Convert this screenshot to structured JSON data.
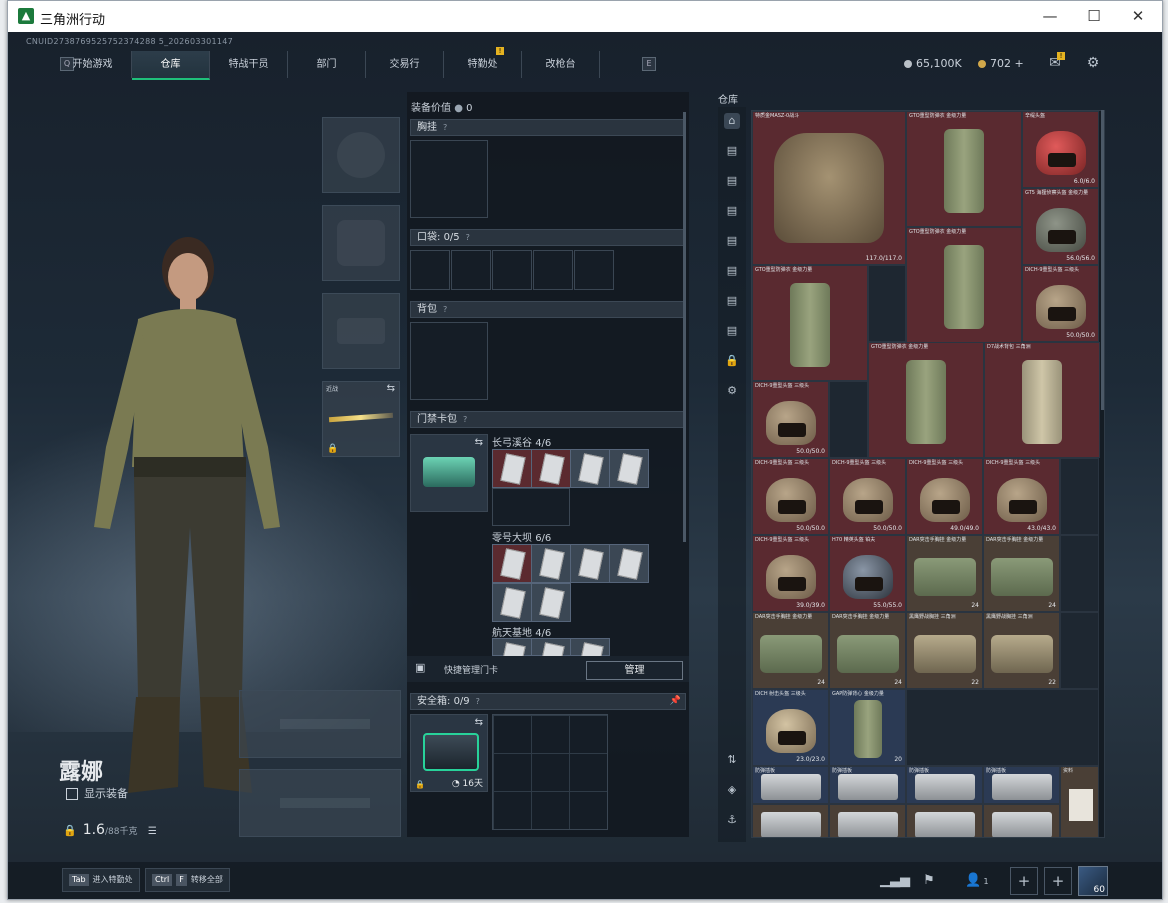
{
  "window": {
    "title": "三角洲行动",
    "minimize": "—",
    "maximize": "☐",
    "close": "✕"
  },
  "header": {
    "uid": "CNUID2738769525752374288 5_202603301147",
    "nav_left_key": "Q",
    "nav_right_key": "E",
    "tabs": [
      {
        "label": "开始游戏",
        "active": false
      },
      {
        "label": "仓库",
        "active": true
      },
      {
        "label": "特战干员",
        "active": false
      },
      {
        "label": "部门",
        "active": false
      },
      {
        "label": "交易行",
        "active": false
      },
      {
        "label": "特勤处",
        "active": false,
        "badge": "!"
      },
      {
        "label": "改枪台",
        "active": false
      }
    ],
    "currency_coins": "65,100K",
    "currency_tokens": "702",
    "plus": "+",
    "mail_badge": "!"
  },
  "character": {
    "name": "露娜",
    "show_equipment": "显示装备",
    "weight": "1.6",
    "weight_max": "/88千克",
    "melee_label": "近战"
  },
  "loadout": {
    "equip_value_label": "装备价值",
    "equip_value": "0",
    "chest_rig": "胸挂",
    "pocket": "口袋:",
    "pocket_count": "0/5",
    "backpack": "背包",
    "keycard_case": "门禁卡包",
    "groups": [
      {
        "name": "长弓溪谷",
        "count": "4/6"
      },
      {
        "name": "零号大坝",
        "count": "6/6"
      },
      {
        "name": "航天基地",
        "count": "4/6"
      }
    ],
    "quick_manage": "快捷管理门卡",
    "manage": "管理",
    "safe_box": "安全箱:",
    "safe_count": "0/9",
    "safe_timer": "16天"
  },
  "storage": {
    "label": "仓库",
    "items": [
      {
        "name": "特质金MASZ-0战斗",
        "dur": "117.0/117.0"
      },
      {
        "name": "GTO重型防弹衣 金级力量",
        "dur": ""
      },
      {
        "name": "辛缇头盔",
        "dur": "6.0/6.0"
      },
      {
        "name": "GT5 海狸侦察头盔 金级力量",
        "dur": "56.0/56.0"
      },
      {
        "name": "GTO重型防弹衣 金级力量",
        "dur": ""
      },
      {
        "name": "GTO重型防弹衣 金级力量",
        "dur": ""
      },
      {
        "name": "DICH-9重型头盔 三级头",
        "dur": "50.0/50.0"
      },
      {
        "name": "GTO重型防弹衣 金级力量",
        "dur": ""
      },
      {
        "name": "D7战术背包 三角洲",
        "dur": ""
      },
      {
        "name": "DICH-9重型头盔 三级头",
        "dur": "50.0/50.0"
      },
      {
        "name": "DICH-9重型头盔 三级头",
        "dur": "50.0/50.0"
      },
      {
        "name": "DICH-9重型头盔 三级头",
        "dur": "50.0/50.0"
      },
      {
        "name": "DICH-9重型头盔 三级头",
        "dur": "49.0/49.0"
      },
      {
        "name": "DICH-9重型头盔 三级头",
        "dur": "43.0/43.0"
      },
      {
        "name": "DICH-9重型头盔 三级头",
        "dur": "39.0/39.0"
      },
      {
        "name": "H70 精英头盔 铂夫",
        "dur": "55.0/55.0"
      },
      {
        "name": "DAR突击手胸挂 金级力量",
        "dur": "24"
      },
      {
        "name": "DAR突击手胸挂 金级力量",
        "dur": "24"
      },
      {
        "name": "DAR突击手胸挂 金级力量",
        "dur": "24"
      },
      {
        "name": "DAR突击手胸挂 金级力量",
        "dur": "24"
      },
      {
        "name": "黑鹰野战胸挂 三角洲",
        "dur": "22"
      },
      {
        "name": "黑鹰野战胸挂 三角洲",
        "dur": "22"
      },
      {
        "name": "DICH 射击头盔 三级头",
        "dur": "23.0/23.0"
      },
      {
        "name": "GAP防弹背心 金级力量",
        "dur": "20"
      },
      {
        "name": "防弹插板",
        "dur": ""
      },
      {
        "name": "防弹插板",
        "dur": ""
      },
      {
        "name": "防弹插板",
        "dur": ""
      },
      {
        "name": "防弹插板",
        "dur": ""
      },
      {
        "name": "资料",
        "dur": ""
      }
    ]
  },
  "footer": {
    "hotkey1_key": "Tab",
    "hotkey1_label": "进入特勤处",
    "hotkey2_key": "Ctrl",
    "hotkey2_key2": "F",
    "hotkey2_label": "转移全部",
    "team_count": "1",
    "avatar_level": "60"
  }
}
